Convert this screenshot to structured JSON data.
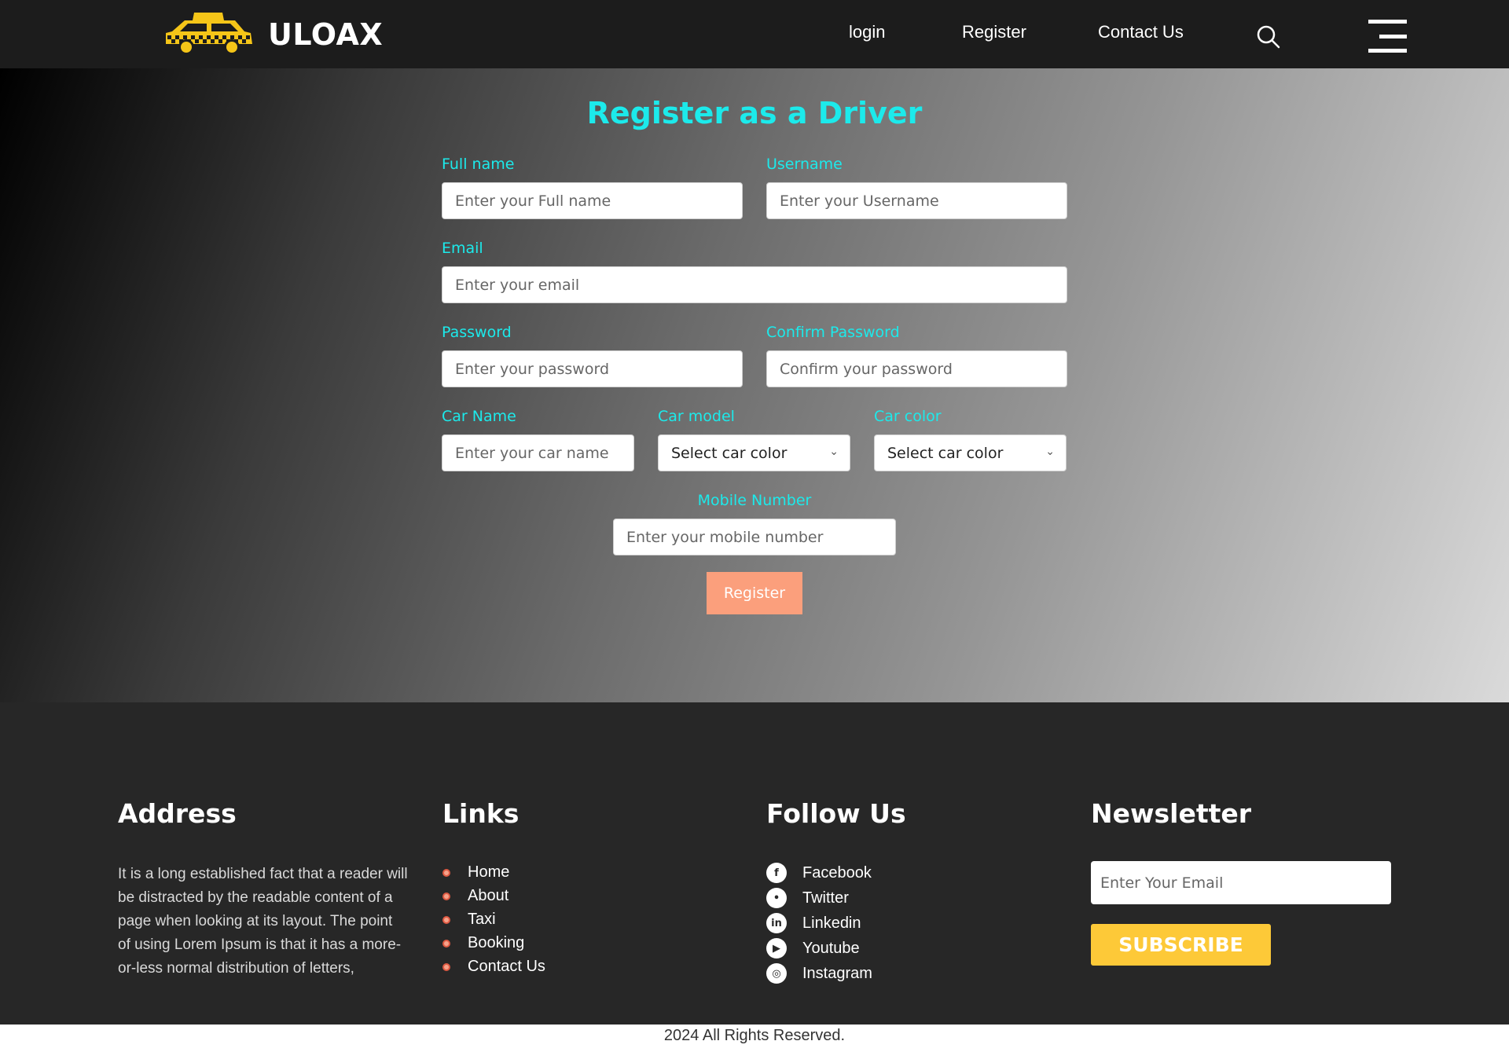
{
  "header": {
    "brand": "ULOAX",
    "nav": [
      "login",
      "Register",
      "Contact Us"
    ],
    "icons": [
      "taxi-icon",
      "search-icon",
      "menu-icon"
    ]
  },
  "form": {
    "title": "Register as a Driver",
    "full_name": {
      "label": "Full name",
      "placeholder": "Enter your Full name"
    },
    "username": {
      "label": "Username",
      "placeholder": "Enter your Username"
    },
    "email": {
      "label": "Email",
      "placeholder": "Enter your email"
    },
    "password": {
      "label": "Password",
      "placeholder": "Enter your password"
    },
    "confirm_password": {
      "label": "Confirm Password",
      "placeholder": "Confirm your password"
    },
    "car_name": {
      "label": "Car Name",
      "placeholder": "Enter your car name"
    },
    "car_model": {
      "label": "Car model",
      "selected": "Select car color"
    },
    "car_color": {
      "label": "Car color",
      "selected": "Select car color"
    },
    "mobile": {
      "label": "Mobile Number",
      "placeholder": "Enter your mobile number"
    },
    "submit_label": "Register"
  },
  "footer": {
    "address": {
      "heading": "Address",
      "text": "It is a long established fact that a reader will be distracted by the readable content of a page when looking at its layout. The point of using Lorem Ipsum is that it has a more-or-less normal distribution of letters,"
    },
    "links": {
      "heading": "Links",
      "items": [
        "Home",
        "About",
        "Taxi",
        "Booking",
        "Contact Us"
      ]
    },
    "follow": {
      "heading": "Follow Us",
      "items": [
        "Facebook",
        "Twitter",
        "Linkedin",
        "Youtube",
        "Instagram"
      ]
    },
    "newsletter": {
      "heading": "Newsletter",
      "placeholder": "Enter Your Email",
      "button": "SUBSCRIBE"
    }
  },
  "copyright": "2024 All Rights Reserved.",
  "colors": {
    "accent": "#1ceaeb",
    "register_button": "#fb9f7c",
    "subscribe_button": "#fdc938",
    "header_bg": "#1c1c1c",
    "footer_bg": "#272727"
  }
}
